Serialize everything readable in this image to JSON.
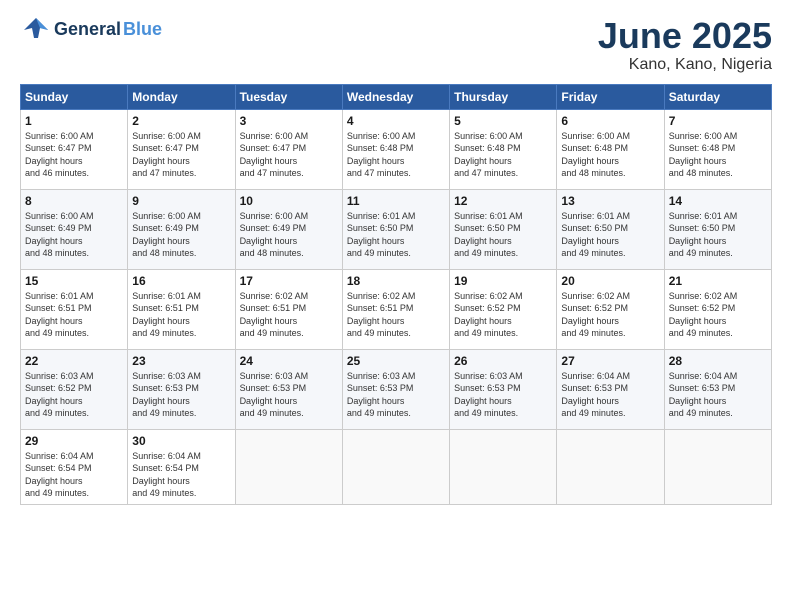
{
  "header": {
    "logo_general": "General",
    "logo_blue": "Blue",
    "title": "June 2025",
    "subtitle": "Kano, Kano, Nigeria"
  },
  "days_of_week": [
    "Sunday",
    "Monday",
    "Tuesday",
    "Wednesday",
    "Thursday",
    "Friday",
    "Saturday"
  ],
  "weeks": [
    [
      {
        "day": "1",
        "sunrise": "6:00 AM",
        "sunset": "6:47 PM",
        "daylight": "12 hours and 46 minutes."
      },
      {
        "day": "2",
        "sunrise": "6:00 AM",
        "sunset": "6:47 PM",
        "daylight": "12 hours and 47 minutes."
      },
      {
        "day": "3",
        "sunrise": "6:00 AM",
        "sunset": "6:47 PM",
        "daylight": "12 hours and 47 minutes."
      },
      {
        "day": "4",
        "sunrise": "6:00 AM",
        "sunset": "6:48 PM",
        "daylight": "12 hours and 47 minutes."
      },
      {
        "day": "5",
        "sunrise": "6:00 AM",
        "sunset": "6:48 PM",
        "daylight": "12 hours and 47 minutes."
      },
      {
        "day": "6",
        "sunrise": "6:00 AM",
        "sunset": "6:48 PM",
        "daylight": "12 hours and 48 minutes."
      },
      {
        "day": "7",
        "sunrise": "6:00 AM",
        "sunset": "6:48 PM",
        "daylight": "12 hours and 48 minutes."
      }
    ],
    [
      {
        "day": "8",
        "sunrise": "6:00 AM",
        "sunset": "6:49 PM",
        "daylight": "12 hours and 48 minutes."
      },
      {
        "day": "9",
        "sunrise": "6:00 AM",
        "sunset": "6:49 PM",
        "daylight": "12 hours and 48 minutes."
      },
      {
        "day": "10",
        "sunrise": "6:00 AM",
        "sunset": "6:49 PM",
        "daylight": "12 hours and 48 minutes."
      },
      {
        "day": "11",
        "sunrise": "6:01 AM",
        "sunset": "6:50 PM",
        "daylight": "12 hours and 49 minutes."
      },
      {
        "day": "12",
        "sunrise": "6:01 AM",
        "sunset": "6:50 PM",
        "daylight": "12 hours and 49 minutes."
      },
      {
        "day": "13",
        "sunrise": "6:01 AM",
        "sunset": "6:50 PM",
        "daylight": "12 hours and 49 minutes."
      },
      {
        "day": "14",
        "sunrise": "6:01 AM",
        "sunset": "6:50 PM",
        "daylight": "12 hours and 49 minutes."
      }
    ],
    [
      {
        "day": "15",
        "sunrise": "6:01 AM",
        "sunset": "6:51 PM",
        "daylight": "12 hours and 49 minutes."
      },
      {
        "day": "16",
        "sunrise": "6:01 AM",
        "sunset": "6:51 PM",
        "daylight": "12 hours and 49 minutes."
      },
      {
        "day": "17",
        "sunrise": "6:02 AM",
        "sunset": "6:51 PM",
        "daylight": "12 hours and 49 minutes."
      },
      {
        "day": "18",
        "sunrise": "6:02 AM",
        "sunset": "6:51 PM",
        "daylight": "12 hours and 49 minutes."
      },
      {
        "day": "19",
        "sunrise": "6:02 AM",
        "sunset": "6:52 PM",
        "daylight": "12 hours and 49 minutes."
      },
      {
        "day": "20",
        "sunrise": "6:02 AM",
        "sunset": "6:52 PM",
        "daylight": "12 hours and 49 minutes."
      },
      {
        "day": "21",
        "sunrise": "6:02 AM",
        "sunset": "6:52 PM",
        "daylight": "12 hours and 49 minutes."
      }
    ],
    [
      {
        "day": "22",
        "sunrise": "6:03 AM",
        "sunset": "6:52 PM",
        "daylight": "12 hours and 49 minutes."
      },
      {
        "day": "23",
        "sunrise": "6:03 AM",
        "sunset": "6:53 PM",
        "daylight": "12 hours and 49 minutes."
      },
      {
        "day": "24",
        "sunrise": "6:03 AM",
        "sunset": "6:53 PM",
        "daylight": "12 hours and 49 minutes."
      },
      {
        "day": "25",
        "sunrise": "6:03 AM",
        "sunset": "6:53 PM",
        "daylight": "12 hours and 49 minutes."
      },
      {
        "day": "26",
        "sunrise": "6:03 AM",
        "sunset": "6:53 PM",
        "daylight": "12 hours and 49 minutes."
      },
      {
        "day": "27",
        "sunrise": "6:04 AM",
        "sunset": "6:53 PM",
        "daylight": "12 hours and 49 minutes."
      },
      {
        "day": "28",
        "sunrise": "6:04 AM",
        "sunset": "6:53 PM",
        "daylight": "12 hours and 49 minutes."
      }
    ],
    [
      {
        "day": "29",
        "sunrise": "6:04 AM",
        "sunset": "6:54 PM",
        "daylight": "12 hours and 49 minutes."
      },
      {
        "day": "30",
        "sunrise": "6:04 AM",
        "sunset": "6:54 PM",
        "daylight": "12 hours and 49 minutes."
      },
      null,
      null,
      null,
      null,
      null
    ]
  ]
}
